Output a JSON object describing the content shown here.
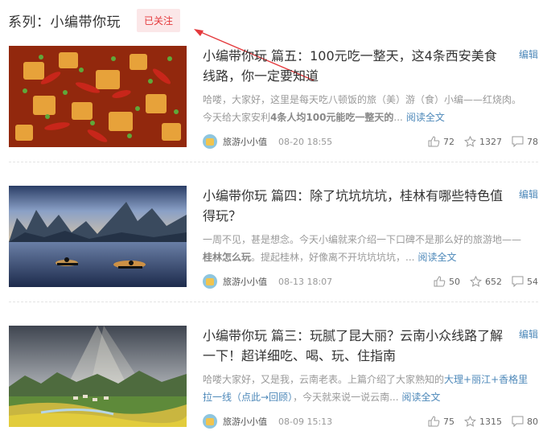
{
  "header": {
    "series_title": "系列：小编带你玩",
    "follow_label": "已关注"
  },
  "articles": [
    {
      "title": "小编带你玩 篇五：100元吃一整天，这4条西安美食线路，你一定要知道",
      "edit_label": "编辑",
      "desc_pre": "哈喽，大家好，这里是每天吃八顿饭的旅（美）游（食）小编——红烧肉。今天给大家安利",
      "desc_bold": "4条人均100元能吃一整天的",
      "desc_post": "...",
      "read_more": "阅读全文",
      "author": "旅游小小值",
      "date": "08-20 18:55",
      "likes": "72",
      "favorites": "1327",
      "comments": "78",
      "thumb_icon": "spicy-chicken-dish-image"
    },
    {
      "title": "小编带你玩 篇四：除了坑坑坑坑，桂林有哪些特色值得玩？",
      "edit_label": "编辑",
      "desc_pre": "一周不见，甚是想念。今天小编就来介绍一下口碑不是那么好的旅游地——",
      "desc_bold": "桂林怎么玩",
      "desc_post": "。提起桂林，好像离不开坑坑坑坑，...",
      "read_more": "阅读全文",
      "author": "旅游小小值",
      "date": "08-13 18:07",
      "likes": "50",
      "favorites": "652",
      "comments": "54",
      "thumb_icon": "guilin-river-image"
    },
    {
      "title": "小编带你玩 篇三：玩腻了昆大丽？云南小众线路了解一下！超详细吃、喝、玩、住指南",
      "edit_label": "编辑",
      "desc_pre": "哈喽大家好，又是我，云南老表。上篇介绍了大家熟知的",
      "desc_link": "大理+丽江+香格里拉一线（点此→回顾）",
      "desc_post": "，今天就来说一说云南...",
      "read_more": "阅读全文",
      "author": "旅游小小值",
      "date": "08-09 15:13",
      "likes": "75",
      "favorites": "1315",
      "comments": "80",
      "thumb_icon": "yunnan-valley-image"
    }
  ]
}
